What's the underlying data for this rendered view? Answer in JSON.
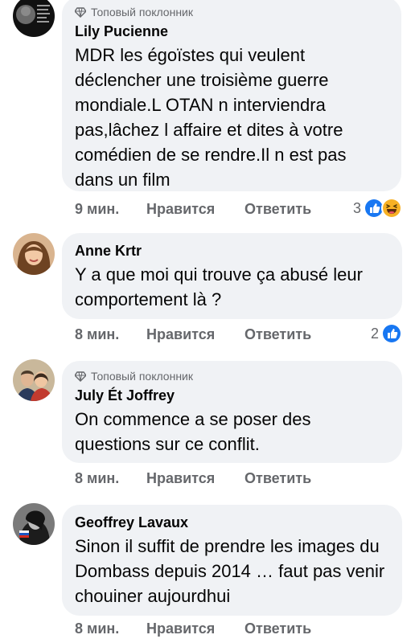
{
  "comments": [
    {
      "badge": "Топовый поклонник",
      "author": "Lily Pucienne",
      "text": "MDR les égoïstes qui veulent déclencher une troisième guerre mondiale.L OTAN n interviendra pas,lâchez l affaire et dites à votre comédien de se rendre.Il n est pas dans un film",
      "time": "9 мин.",
      "like_label": "Нравится",
      "reply_label": "Ответить",
      "reaction_count": "3",
      "reactions": [
        "like-icon",
        "haha-icon"
      ]
    },
    {
      "author": "Anne Krtr",
      "text": "Y a que moi qui trouve ça abusé leur comportement là ?",
      "time": "8 мин.",
      "like_label": "Нравится",
      "reply_label": "Ответить",
      "reaction_count": "2",
      "reactions": [
        "like-icon"
      ]
    },
    {
      "badge": "Топовый поклонник",
      "author": "July Ét Joffrey",
      "text": "On commence a se poser des questions sur ce conflit.",
      "time": "8 мин.",
      "like_label": "Нравится",
      "reply_label": "Ответить"
    },
    {
      "author": "Geoffrey Lavaux",
      "text": "Sinon il suffit de prendre les images du Dombass depuis 2014 … faut pas venir chouiner aujourdhui",
      "time": "8 мин.",
      "like_label": "Нравится",
      "reply_label": "Ответить"
    }
  ],
  "colors": {
    "bubble": "#f0f2f5",
    "meta_text": "#65676b",
    "like_blue": "#1877f2",
    "haha_yellow": "#f7b125"
  }
}
